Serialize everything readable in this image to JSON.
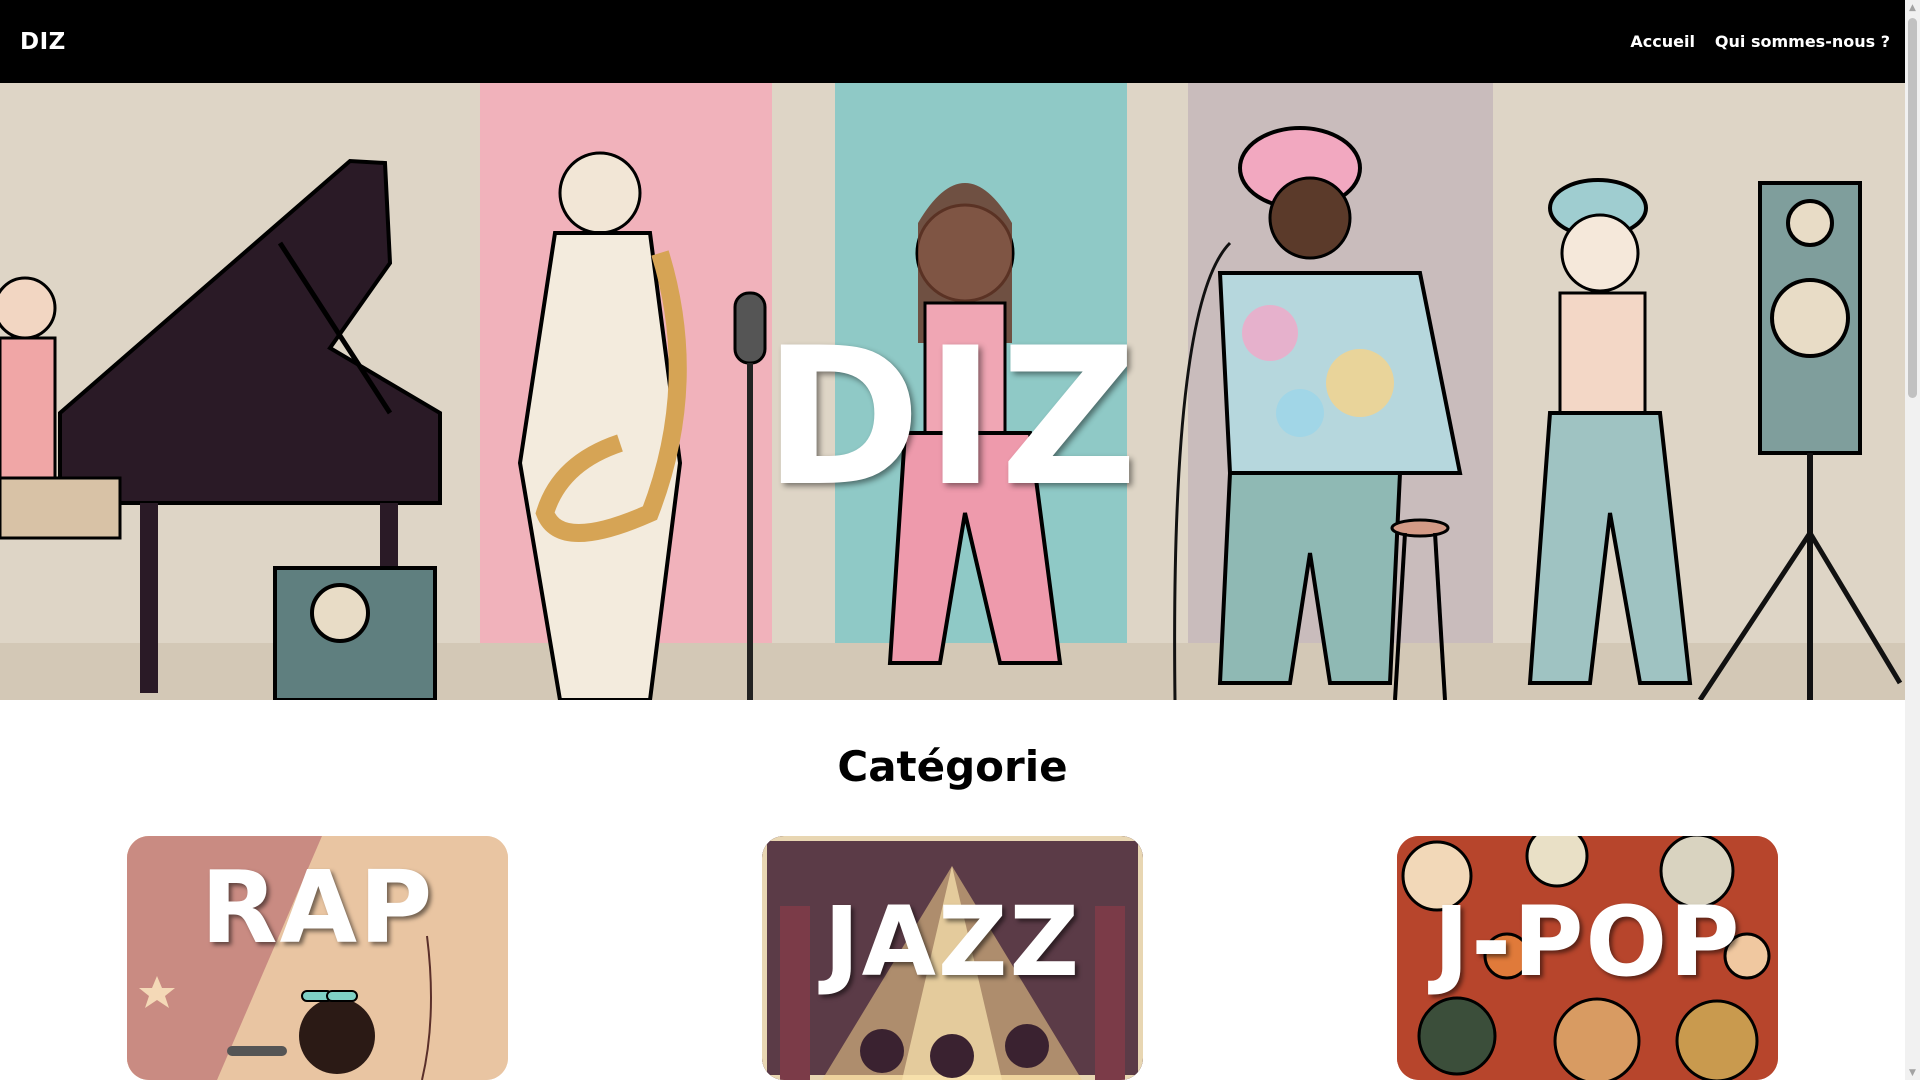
{
  "navbar": {
    "brand": "DIZ",
    "links": [
      "Accueil",
      "Qui sommes-nous ?"
    ]
  },
  "hero": {
    "title": "DIZ"
  },
  "categories": {
    "title": "Catégorie",
    "cards": [
      {
        "label": "RAP"
      },
      {
        "label": "JAZZ"
      },
      {
        "label": "J-POP"
      }
    ]
  },
  "colors": {
    "navbar_bg": "#000000",
    "hero_bg": "#ded5c6",
    "pink_panel": "#f1b2bb",
    "teal_panel": "#8fc9c6",
    "grey_panel": "#c9bcbc"
  }
}
